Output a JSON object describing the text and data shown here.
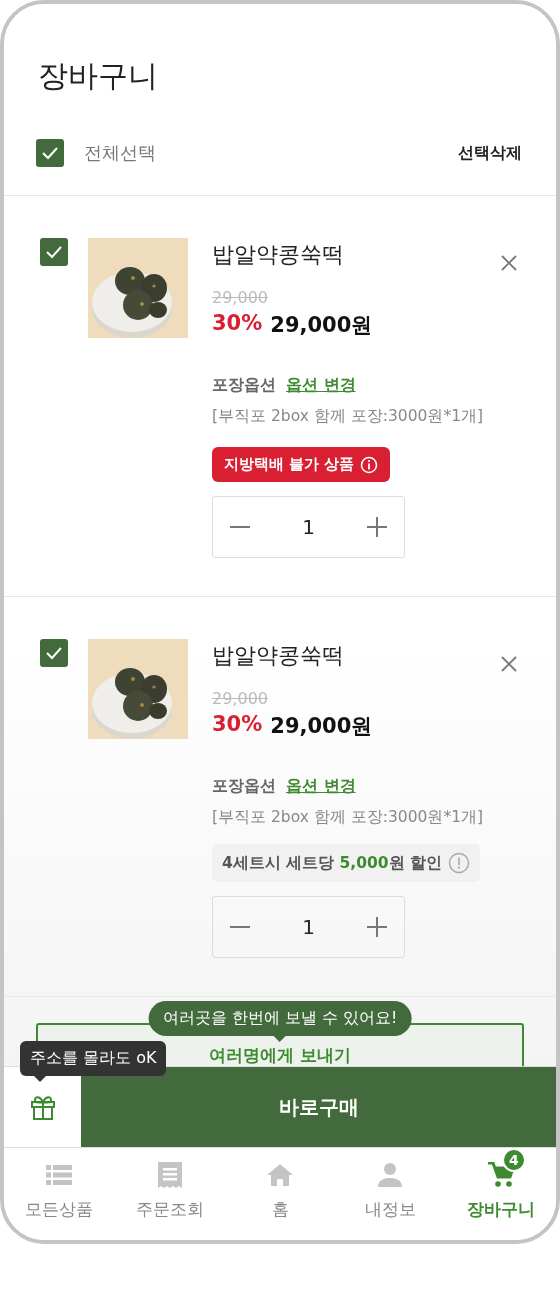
{
  "title": "장바구니",
  "select_all": {
    "label": "전체선택",
    "checked": true
  },
  "delete_selected": "선택삭제",
  "items": [
    {
      "checked": true,
      "name": "밥알약콩쑥떡",
      "original_price": "29,000",
      "discount": "30%",
      "price": "29,000원",
      "option_label": "포장옵션",
      "option_link": "옵션 변경",
      "option_detail": "[부직포 2box 함께 포장:3000원*1개]",
      "notice": {
        "kind": "warning",
        "text": "지방택배 불가 상품"
      },
      "quantity": "1"
    },
    {
      "checked": true,
      "name": "밥알약콩쑥떡",
      "original_price": "29,000",
      "discount": "30%",
      "price": "29,000원",
      "option_label": "포장옵션",
      "option_link": "옵션 변경",
      "option_detail": "[부직포 2box 함께 포장:3000원*1개]",
      "notice": {
        "kind": "promo",
        "text": "4세트시 세트당 ",
        "highlight": "5,000",
        "text_after": "원 할인"
      },
      "quantity": "1"
    }
  ],
  "multi_send": {
    "label": "여러명에게 보내기",
    "tooltip": "여러곳을 한번에 보낼 수 있어요!"
  },
  "gift": {
    "tooltip": "주소를 몰라도 oK"
  },
  "buy_button": "바로구매",
  "tabs": [
    {
      "label": "모든상품",
      "selected": false
    },
    {
      "label": "주문조회",
      "selected": false
    },
    {
      "label": "홈",
      "selected": false
    },
    {
      "label": "내정보",
      "selected": false
    },
    {
      "label": "장바구니",
      "selected": true,
      "badge": "4"
    }
  ]
}
